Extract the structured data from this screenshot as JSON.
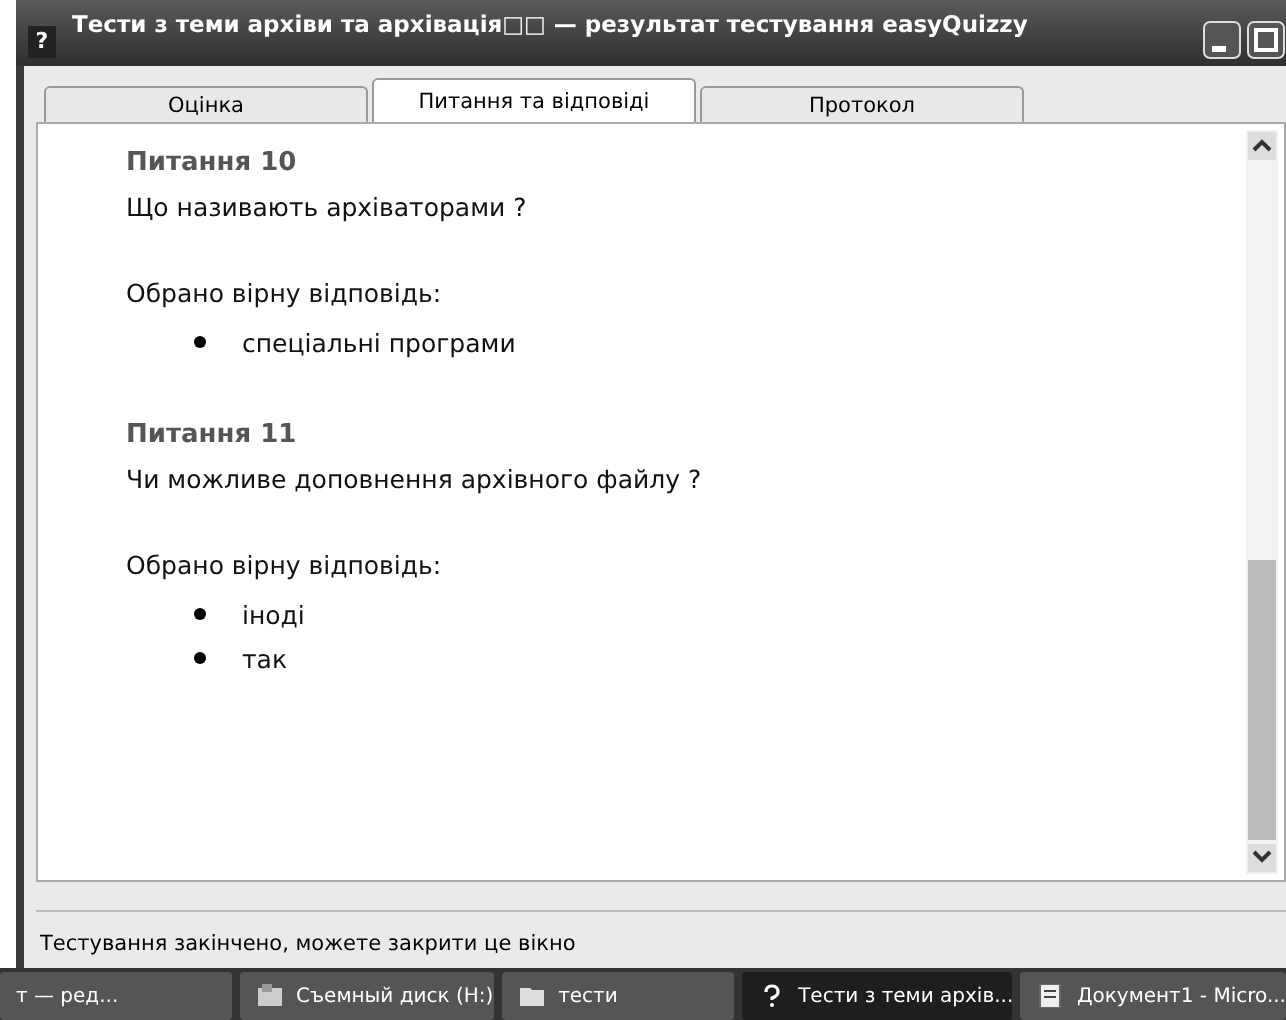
{
  "window": {
    "title": "Тести з теми архіви та архівація□□ — результат тестування easyQuizzy",
    "icon": "?"
  },
  "tabs": [
    {
      "label": "Оцінка",
      "selected": false
    },
    {
      "label": "Питання та відповіді",
      "selected": true
    },
    {
      "label": "Протокол",
      "selected": false
    }
  ],
  "questions": [
    {
      "number": "Питання 10",
      "text": "Що називають архіваторами ?",
      "answer_label": "Обрано вірну відповідь:",
      "answers": [
        "спеціальні програми"
      ]
    },
    {
      "number": "Питання 11",
      "text": "Чи можливе доповнення архівного файлу ?",
      "answer_label": "Обрано вірну відповідь:",
      "answers": [
        "іноді",
        "так"
      ]
    }
  ],
  "status_bar": "Тестування закінчено, можете закрити це вікно",
  "taskbar": [
    {
      "label": "т — ред...",
      "kind": "none",
      "selected": false
    },
    {
      "label": "Съемный диск (H:)",
      "kind": "drive",
      "selected": false
    },
    {
      "label": "тести",
      "kind": "folder",
      "selected": false
    },
    {
      "label": "Тести з теми архів...",
      "kind": "app",
      "selected": true
    },
    {
      "label": "Документ1 - Micro...",
      "kind": "doc",
      "selected": false
    }
  ]
}
